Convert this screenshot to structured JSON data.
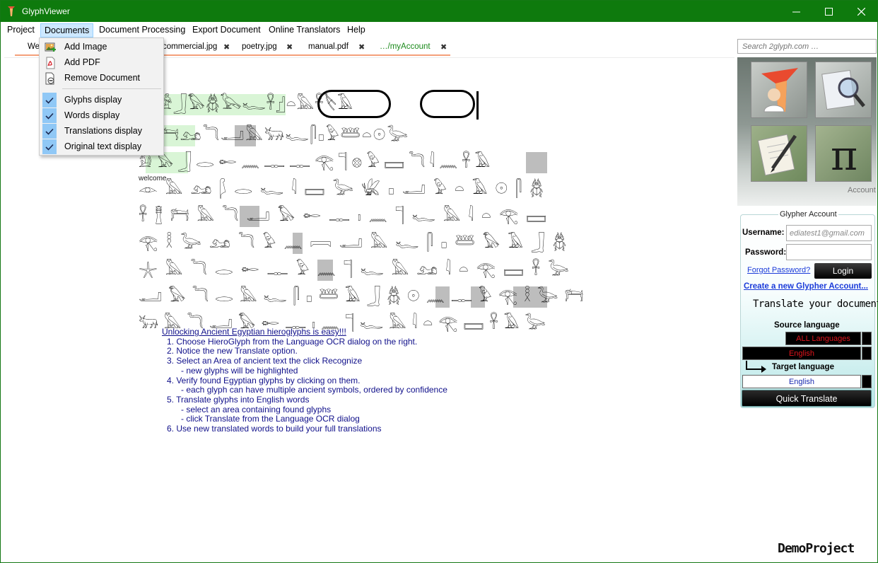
{
  "window": {
    "title": "GlyphViewer",
    "title_bar_color": "#0e7a0d"
  },
  "menu": {
    "items": [
      "Project",
      "Documents",
      "Document Processing",
      "Export Document",
      "Online Translators",
      "Help"
    ],
    "active": "Documents"
  },
  "tabs": [
    {
      "label": "We",
      "close": "✖"
    },
    {
      "label": "commercial.jpg",
      "close": "✖"
    },
    {
      "label": "poetry.jpg",
      "close": "✖"
    },
    {
      "label": "manual.pdf",
      "close": "✖"
    },
    {
      "label": "…/myAccount",
      "close": "✖",
      "color": "#1a8a1a"
    }
  ],
  "search": {
    "placeholder": "Search 2glyph.com …"
  },
  "documents_menu": {
    "items": [
      {
        "label": "Add Image",
        "icon": "add-image-icon"
      },
      {
        "label": "Add PDF",
        "icon": "pdf-icon"
      },
      {
        "label": "Remove Document",
        "icon": "remove-document-icon"
      },
      {
        "label": "Glyphs display",
        "checked": true
      },
      {
        "label": "Words display",
        "checked": true
      },
      {
        "label": "Translations display",
        "checked": true
      },
      {
        "label": "Original text display",
        "checked": true
      }
    ]
  },
  "document": {
    "word_label": "welcome",
    "instructions": {
      "heading": "Unlocking Ancient Egyptian hieroglyphs is easy!!!",
      "lines": [
        "1. Choose HieroGlyph from the Language OCR dialog on the right.",
        "2. Notice the new Translate option.",
        "3. Select an Area of ancient text the click Recognize",
        "      - new glyphs will be highlighted",
        "4. Verify found Egyptian glyphs by clicking on them.",
        "      - each glyph can have multiple ancient symbols, ordered by confidence",
        "5. Translate glyphs into English words",
        "      - select an area containing found glyphs",
        "      - click Translate from the Language OCR dialog",
        "6. Use new translated words to build your full translations"
      ]
    },
    "glyph_rows": [
      "𓀀𓃀𓅃𓆣𓅂𓆑𓋹𓊨𓏏𓅓𓋹𓌸𓄿",
      "𓁀𓃭𓆓𓂝𓅓𓃒𓆑𓋴𓊪𓅱𓆷𓏏𓇳𓅬",
      "𓀁𓅃𓃀𓂋𓄡𓈖𓊃𓊃𓂀𓊹𓊖𓅱𓈙𓆓𓇋𓈖𓋹𓄿",
      "𓁹𓅓𓃭𓆄𓂋𓆑𓇋𓈙𓅬𓆤𓊪𓂝𓅱𓏏𓄿𓇳𓋴𓆣",
      "𓋹𓊽𓁀𓅓𓆓𓂝𓅃𓄡𓊃𓏤𓈖𓊹𓆑𓅓𓇋𓏏𓂀𓈙",
      "𓂀𓎛𓅬𓃭𓆓𓅱𓈖𓇯𓂝𓅓𓆑𓋴𓊪𓆷𓅃𓄿𓃀𓆣",
      "𓇼𓅓𓆓𓂋𓄡𓊃𓅱𓈖𓊹𓆑𓅓𓃭𓇋𓏏𓂀𓈙𓋹𓅬",
      "𓂝𓅃𓆓𓂋𓅓𓆑𓋴𓊪𓆷𓄿𓃀𓆣𓇳𓈖𓊃𓅱𓂀𓎛𓅬𓁀",
      "𓃒𓅓𓆓𓂝𓅃𓄡𓊃𓏤𓈖𓊹𓆑𓅓𓇋𓏏𓂀𓈙𓋹𓄿𓅬"
    ]
  },
  "account_panel": {
    "tiles": [
      "user-icon",
      "magnifier-icon",
      "pencil-icon",
      "pi-icon"
    ],
    "account_link": "Account",
    "box_title": "Glypher Account",
    "username_label": "Username:",
    "username_value": "ediatest1@gmail.com",
    "password_label": "Password:",
    "password_value": "",
    "forgot_link": "Forgot Password?",
    "login_button": "Login",
    "create_link": "Create a new Glypher Account...",
    "translate_heading": "Translate your document",
    "source_heading": "Source language",
    "source_value_1": "ALL Languages",
    "source_value_2": "English",
    "target_heading": "Target language",
    "target_value": "English",
    "quick_translate_button": "Quick Translate"
  },
  "footer": {
    "project_name": "DemoProject"
  }
}
